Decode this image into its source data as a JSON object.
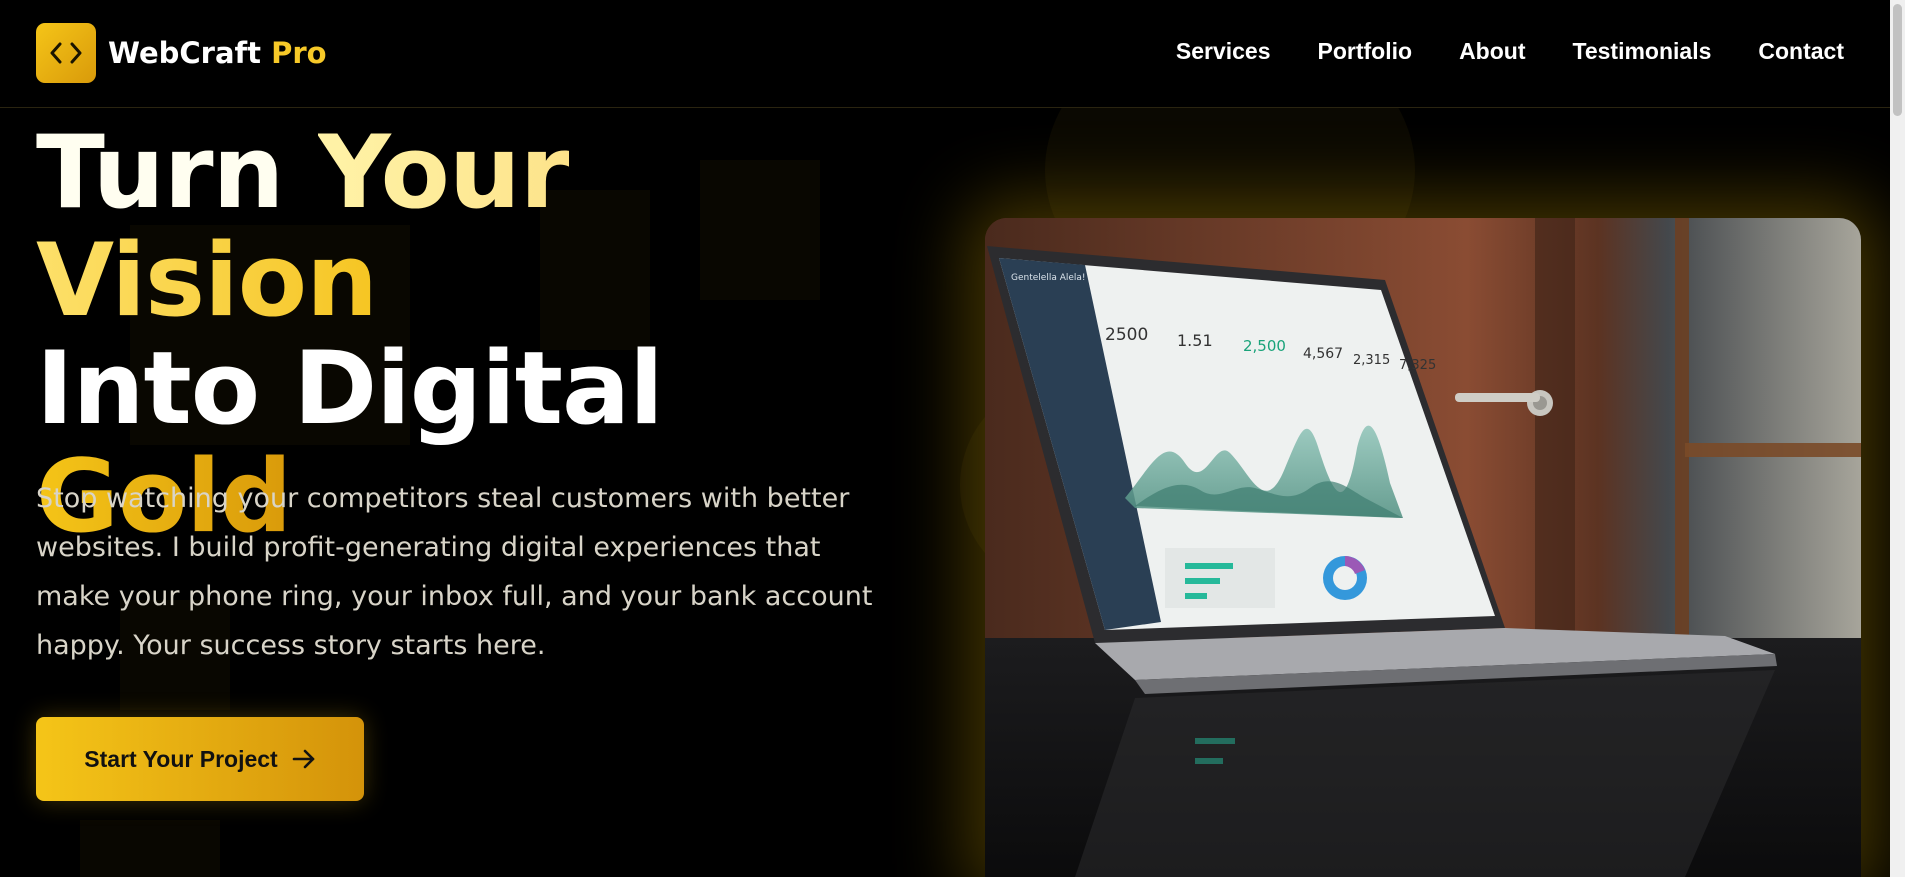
{
  "brand": {
    "name_part1": "WebCraft",
    "name_part2": "Pro",
    "logo_icon": "code-brackets-icon"
  },
  "nav": {
    "items": [
      "Services",
      "Portfolio",
      "About",
      "Testimonials",
      "Contact"
    ]
  },
  "hero": {
    "title_line1": {
      "a": "Turn",
      "b": "Your",
      "c": "Vision"
    },
    "title_line2": "Into Digital",
    "title_line3": "Gold",
    "subtitle": "Stop watching your competitors steal customers with better websites. I build profit-generating digital experiences that make your phone ring, your inbox full, and your bank account happy. Your success story starts here.",
    "cta_label": "Start Your Project",
    "cta_icon": "arrow-right-icon"
  },
  "dashboard": {
    "app_name": "Gentelella Alela!",
    "stats": [
      "2500",
      "1.51",
      "2,500",
      "4,567",
      "2,315",
      "7,325"
    ]
  },
  "colors": {
    "accent": "#f5c518",
    "accent_dark": "#d99a0a",
    "background": "#000000"
  }
}
